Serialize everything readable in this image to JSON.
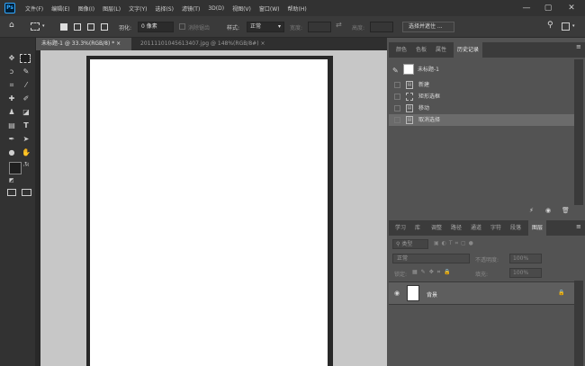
{
  "app": {
    "logo": "Ps"
  },
  "menu": [
    "文件(F)",
    "编辑(E)",
    "图像(I)",
    "图层(L)",
    "文字(Y)",
    "选择(S)",
    "滤镜(T)",
    "3D(D)",
    "视图(V)",
    "窗口(W)",
    "帮助(H)"
  ],
  "window_controls": {
    "minimize": "—",
    "restore": "▢",
    "close": "✕"
  },
  "options": {
    "feather_label": "羽化:",
    "feather_value": "0 像素",
    "antialias_label": "消除锯齿",
    "style_label": "样式:",
    "style_value": "正常",
    "width_label": "宽度:",
    "height_label": "高度:",
    "select_mask_button": "选择并遮住 ..."
  },
  "doc_tabs": [
    {
      "label": "未标题-1 @ 33.3%(RGB/8) *",
      "close": "×"
    },
    {
      "label": "20111101045613407.jpg @ 148%(RGB/8#)",
      "close": "×"
    }
  ],
  "panel_top_tabs": [
    "颜色",
    "色板",
    "属性",
    "历史记录"
  ],
  "history": {
    "snapshot": "未标题-1",
    "items": [
      "新建",
      "矩形选框",
      "移动",
      "取消选择"
    ],
    "selected_index": 3
  },
  "panel_bottom_tabs": [
    "学习",
    "库",
    "调整",
    "路径",
    "通道",
    "字符",
    "段落",
    "图层"
  ],
  "layers": {
    "filter_kind": "类型",
    "blend_mode": "正常",
    "opacity_label": "不透明度:",
    "opacity_value": "100%",
    "lock_label": "锁定:",
    "fill_label": "填充:",
    "fill_value": "100%",
    "items": [
      {
        "name": "背景",
        "visible": true,
        "locked": true
      }
    ]
  },
  "colors": {
    "accent": "#31a8ff",
    "menubar": "#323232",
    "panel": "#535353",
    "canvas": "#ffffff",
    "pasteboard": "#c7c7c7"
  }
}
